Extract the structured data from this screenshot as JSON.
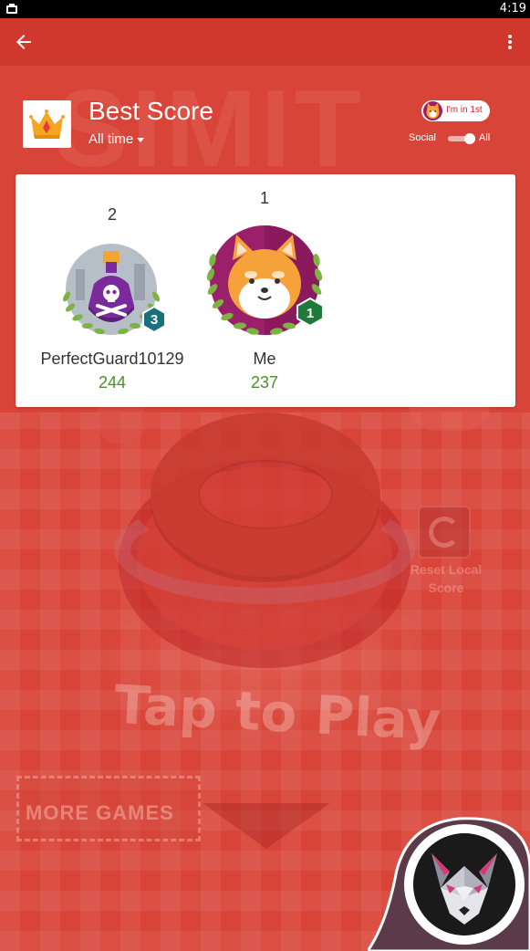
{
  "status_bar": {
    "time": "4:19"
  },
  "app_bar": {
    "back_icon": "arrow-left-icon",
    "more_icon": "more-vert-icon"
  },
  "header": {
    "title": "Best Score",
    "time_filter": "All time",
    "rank_chip": "I'm in 1st",
    "social_label": "Social",
    "all_label": "All",
    "toggle_state": "all"
  },
  "leaderboard": {
    "players": [
      {
        "rank": "2",
        "name": "PerfectGuard10129",
        "score": "244",
        "level": "3",
        "avatar": "potion-skull-avatar"
      },
      {
        "rank": "1",
        "name": "Me",
        "score": "237",
        "level": "1",
        "avatar": "shiba-dog-avatar"
      }
    ]
  },
  "background_game": {
    "tap_text": "Tap to Play",
    "more_games": "MORE GAMES",
    "reset_label": "Reset Local Score"
  },
  "colors": {
    "app_bar": "#d0382d",
    "overlay": "#d9463a",
    "score_green": "#4a8f2c",
    "level_teal": "#17707a",
    "level_green": "#1f7a3a"
  }
}
